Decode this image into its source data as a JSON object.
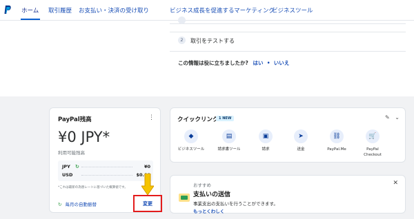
{
  "nav": {
    "logo": "paypal-logo",
    "items": [
      {
        "label": "ホーム",
        "active": true
      },
      {
        "label": "取引履歴"
      },
      {
        "label": "お支払い・決済の受け取り"
      },
      {
        "label": "ビジネス成長を促進するマーケティング"
      },
      {
        "label": "ビジネスツール"
      }
    ]
  },
  "steps": {
    "step2_num": "2",
    "step2_label": "取引をテストする"
  },
  "feedback": {
    "question": "この情報は役に立ちましたか?",
    "yes": "はい",
    "no": "いいえ"
  },
  "balance": {
    "title": "PayPal残高",
    "amount": "¥0 JPY*",
    "subtitle": "利用可能残高",
    "rows": [
      {
        "currency": "JPY",
        "value": "¥0"
      },
      {
        "currency": "USD",
        "value": "$0.00"
      }
    ],
    "note": "*これは最新の為替レートに基づいた概算値です。",
    "auto_transfer": "毎月の自動振替",
    "change": "変更",
    "highlight_color": "#e31b1b",
    "arrow_color": "#f5c400"
  },
  "quicklinks": {
    "title": "クイックリンク",
    "badge": "1 NEW",
    "items": [
      {
        "label": "ビジネスツール",
        "icon": "layers-icon"
      },
      {
        "label": "請求書ツール",
        "icon": "invoice-icon"
      },
      {
        "label": "請求",
        "icon": "request-icon"
      },
      {
        "label": "送金",
        "icon": "send-icon"
      },
      {
        "label": "PayPal.Me",
        "icon": "link-icon"
      },
      {
        "label": "PayPal\nCheckout",
        "icon": "cart-icon"
      }
    ]
  },
  "recommend": {
    "eyebrow": "おすすめ",
    "title": "支払いの送信",
    "body": "事業支出の支払いを行うことができます。",
    "link": "もっとくわしく"
  }
}
